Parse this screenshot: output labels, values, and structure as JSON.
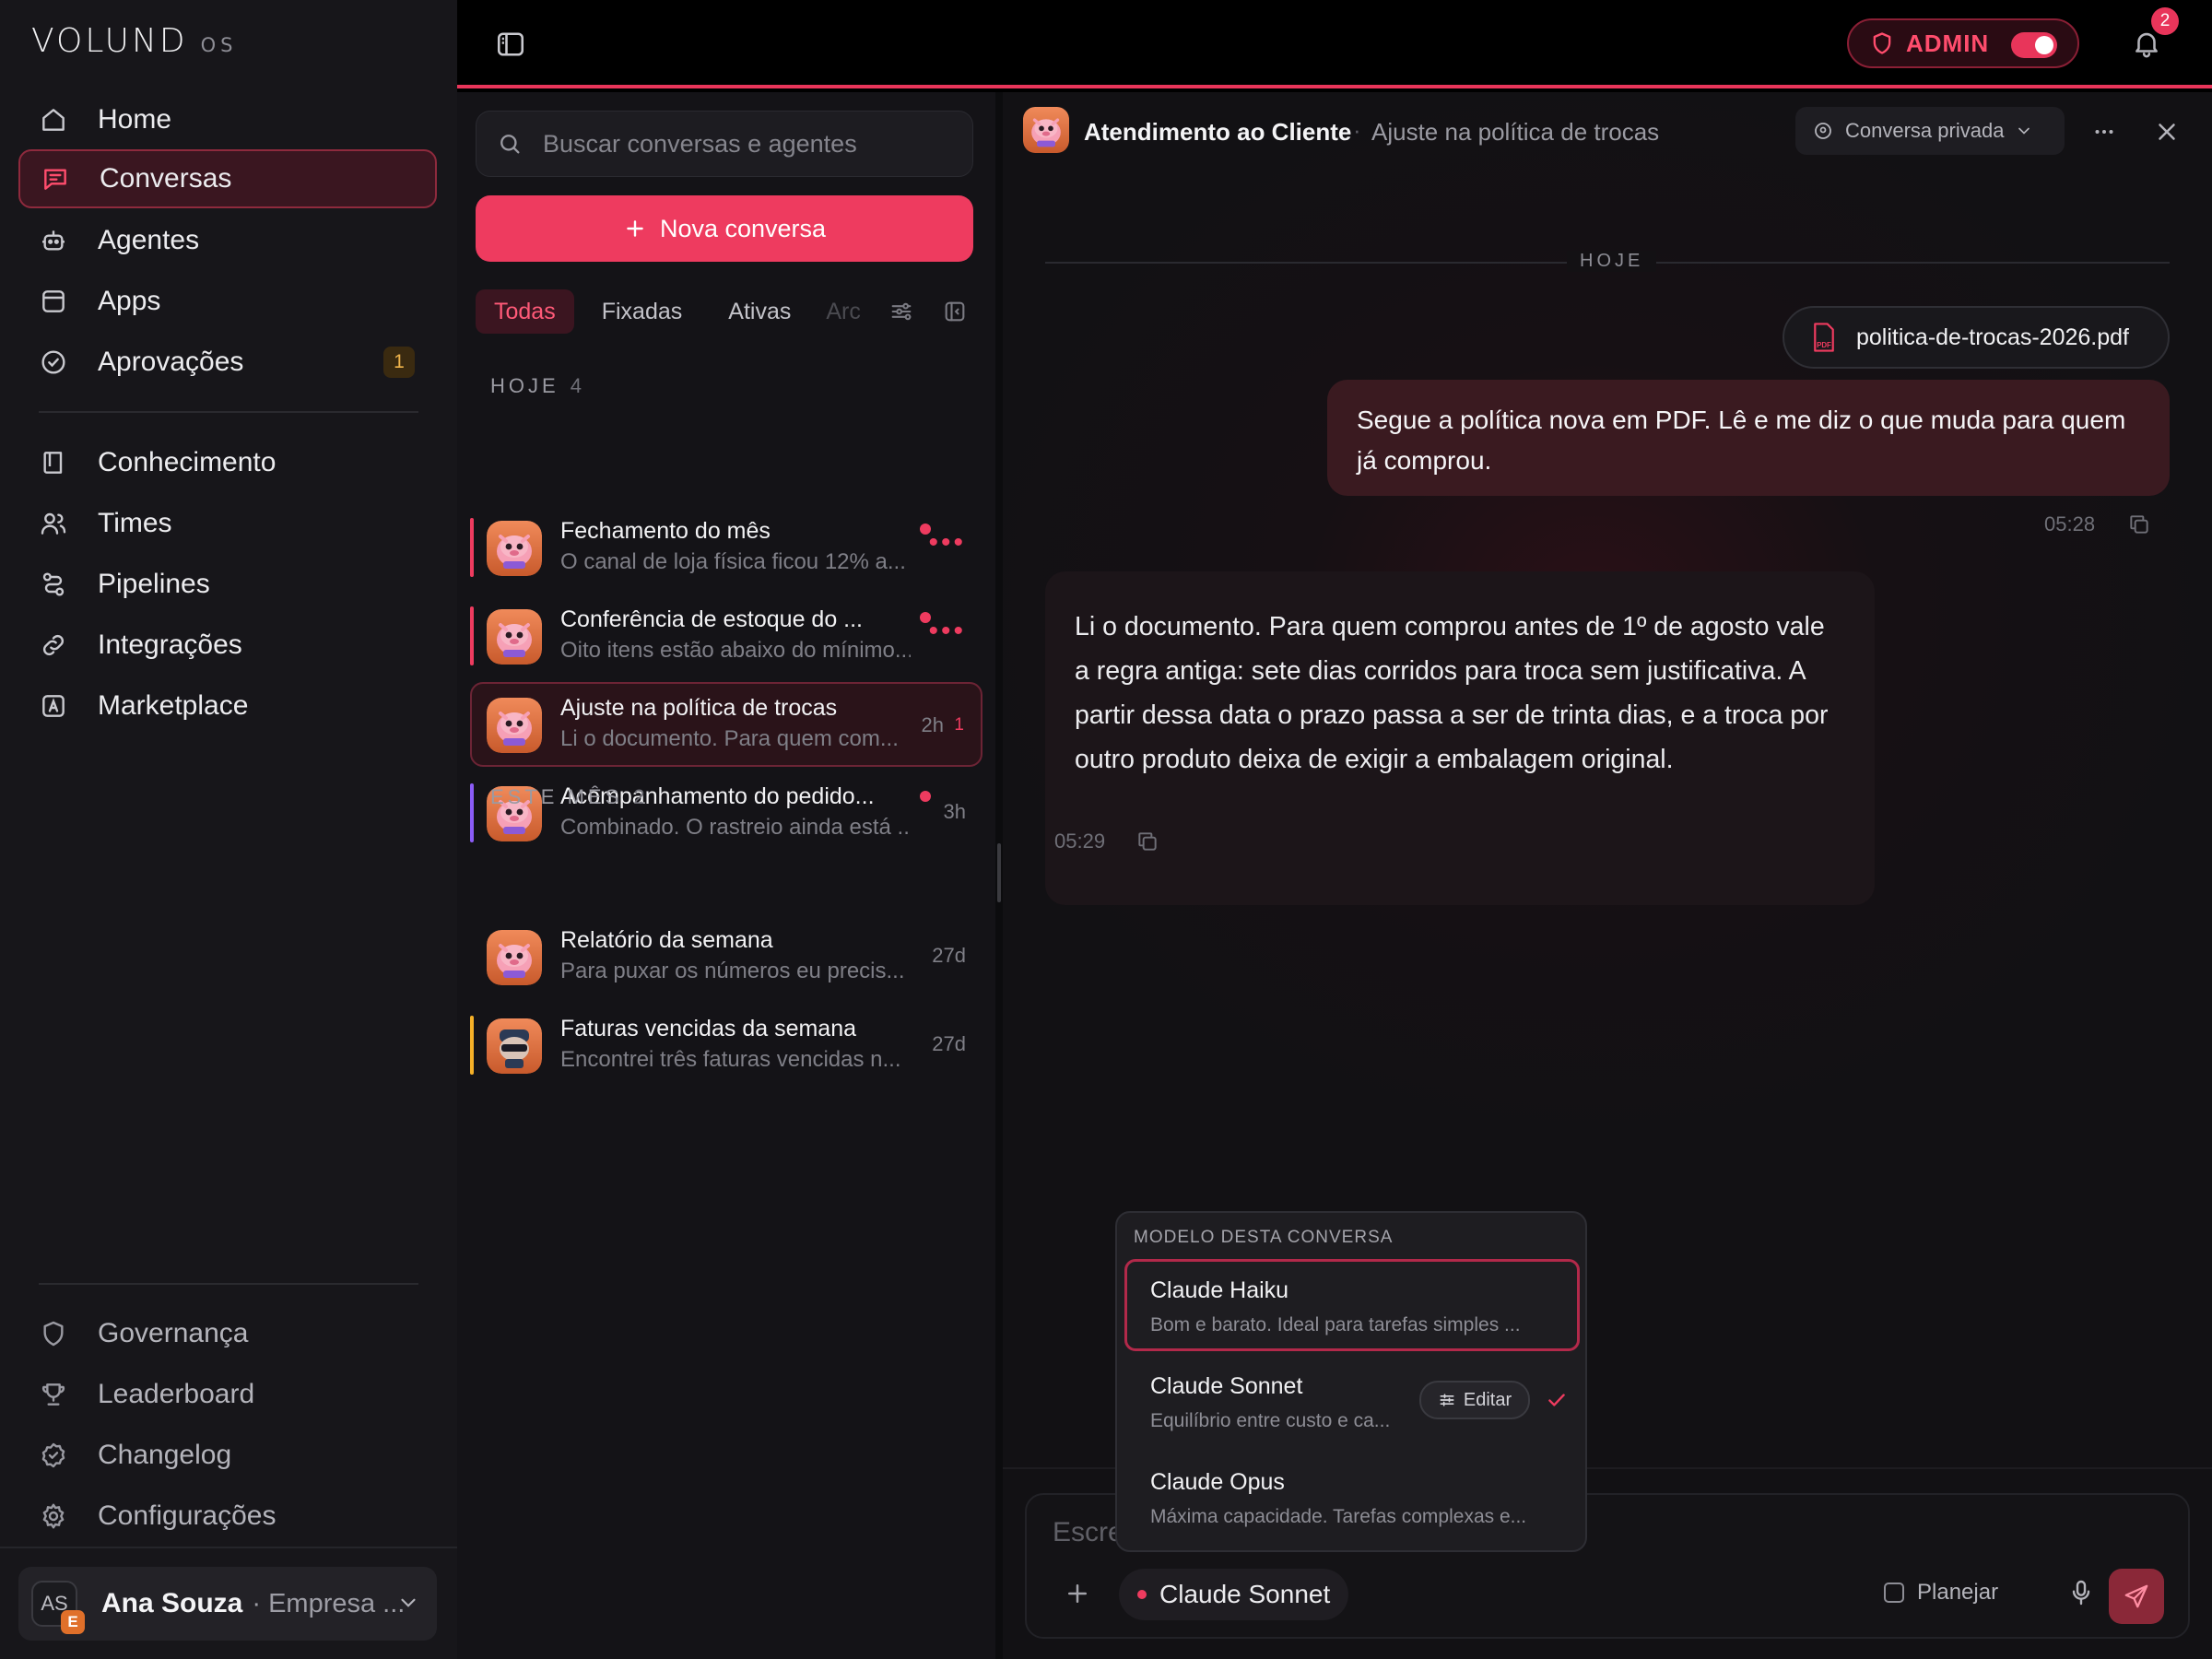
{
  "brand": {
    "name": "VOLUND",
    "suffix": "OS"
  },
  "nav": {
    "primary": [
      {
        "label": "Home",
        "icon": "home-icon"
      },
      {
        "label": "Conversas",
        "icon": "chat-icon",
        "active": true
      },
      {
        "label": "Agentes",
        "icon": "robot-icon"
      },
      {
        "label": "Apps",
        "icon": "app-window-icon"
      },
      {
        "label": "Aprovações",
        "icon": "check-circle-icon",
        "badge": "1"
      }
    ],
    "secondary": [
      {
        "label": "Conhecimento",
        "icon": "book-icon"
      },
      {
        "label": "Times",
        "icon": "users-icon"
      },
      {
        "label": "Pipelines",
        "icon": "pipeline-icon"
      },
      {
        "label": "Integrações",
        "icon": "link-icon"
      },
      {
        "label": "Marketplace",
        "icon": "marketplace-icon"
      }
    ],
    "footer": [
      {
        "label": "Governança",
        "icon": "shield-icon"
      },
      {
        "label": "Leaderboard",
        "icon": "trophy-icon"
      },
      {
        "label": "Changelog",
        "icon": "changelog-icon"
      },
      {
        "label": "Configurações",
        "icon": "gear-icon"
      }
    ]
  },
  "user": {
    "initials": "AS",
    "org_badge": "E",
    "name": "Ana Souza",
    "org": "· Empresa ..."
  },
  "topbar": {
    "admin_label": "ADMIN",
    "admin_enabled": true,
    "notifications": "2"
  },
  "list": {
    "search_placeholder": "Buscar conversas e agentes",
    "new_button": "Nova conversa",
    "tabs": [
      "Todas",
      "Fixadas",
      "Ativas",
      "Arc"
    ],
    "sections": [
      {
        "label": "HOJE",
        "count": "4"
      },
      {
        "label": "ESTE MÊS",
        "count": "2"
      }
    ],
    "conversations": [
      {
        "title": "Fechamento do mês",
        "preview": "O canal de loja física ficou 12% a...",
        "time": "",
        "unread_dot": true,
        "menu": true
      },
      {
        "title": "Conferência de estoque do ...",
        "preview": "Oito itens estão abaixo do mínimo...",
        "time": "",
        "unread_dot": true,
        "menu": true
      },
      {
        "title": "Ajuste na política de trocas",
        "preview": "Li o documento. Para quem com...",
        "time": "2h",
        "unread": "1",
        "selected": true
      },
      {
        "title": "Acompanhamento do pedido...",
        "preview": "Combinado. O rastreio ainda está ...",
        "time": "3h",
        "unread_dot": true
      },
      {
        "title": "Relatório da semana",
        "preview": "Para puxar os números eu precis...",
        "time": "27d"
      },
      {
        "title": "Faturas vencidas da semana",
        "preview": "Encontrei três faturas vencidas n...",
        "time": "27d"
      }
    ],
    "colors": {
      "accent": "#ee3b5f",
      "purple": "#8b5cf6",
      "amber": "#f5b027"
    }
  },
  "chat": {
    "agent_name": "Atendimento ao Cliente",
    "separator": "·",
    "conversation_title": "Ajuste na política de trocas",
    "privacy": "Conversa privada",
    "day_label": "HOJE",
    "attachment": "politica-de-trocas-2026.pdf",
    "attachment_icon_label": "PDF",
    "user_message": "Segue a política nova em PDF. Lê e me diz o que muda para quem já comprou.",
    "user_time": "05:28",
    "bot_message": "Li o documento. Para quem comprou antes de 1º de agosto vale a regra antiga: sete dias corridos para troca sem justificativa. A partir dessa data o prazo passa a ser de trinta dias, e a troca por outro produto deixa de exigir a embalagem original.",
    "bot_time": "05:29",
    "composer_placeholder": "Escreva",
    "selected_model": "Claude Sonnet",
    "plan_label": "Planejar"
  },
  "model_menu": {
    "title": "MODELO DESTA CONVERSA",
    "edit_label": "Editar",
    "options": [
      {
        "name": "Claude Haiku",
        "desc": "Bom e barato. Ideal para tarefas simples ...",
        "highlighted": true
      },
      {
        "name": "Claude Sonnet",
        "desc": "Equilíbrio entre custo e ca...",
        "selected": true
      },
      {
        "name": "Claude Opus",
        "desc": "Máxima capacidade. Tarefas complexas e..."
      }
    ]
  }
}
